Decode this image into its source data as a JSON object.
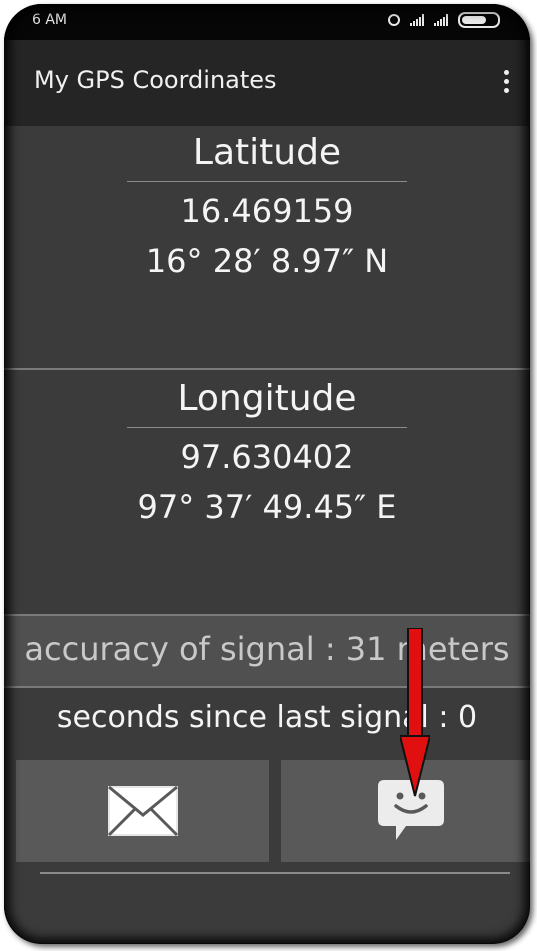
{
  "statusbar": {
    "time": "6 AM"
  },
  "appbar": {
    "title": "My GPS Coordinates"
  },
  "latitude": {
    "label": "Latitude",
    "decimal": "16.469159",
    "dms": "16° 28′ 8.97″ N"
  },
  "longitude": {
    "label": "Longitude",
    "decimal": "97.630402",
    "dms": "97° 37′ 49.45″ E"
  },
  "accuracy_text": "accuracy of signal : 31 meters",
  "seconds_text": "seconds since last signal : 0",
  "buttons": {
    "email_icon": "envelope-icon",
    "sms_icon": "smiley-message-icon"
  },
  "colors": {
    "background": "#3b3b3b",
    "appbar": "#252525",
    "button": "#595959",
    "arrow": "#e01010"
  }
}
